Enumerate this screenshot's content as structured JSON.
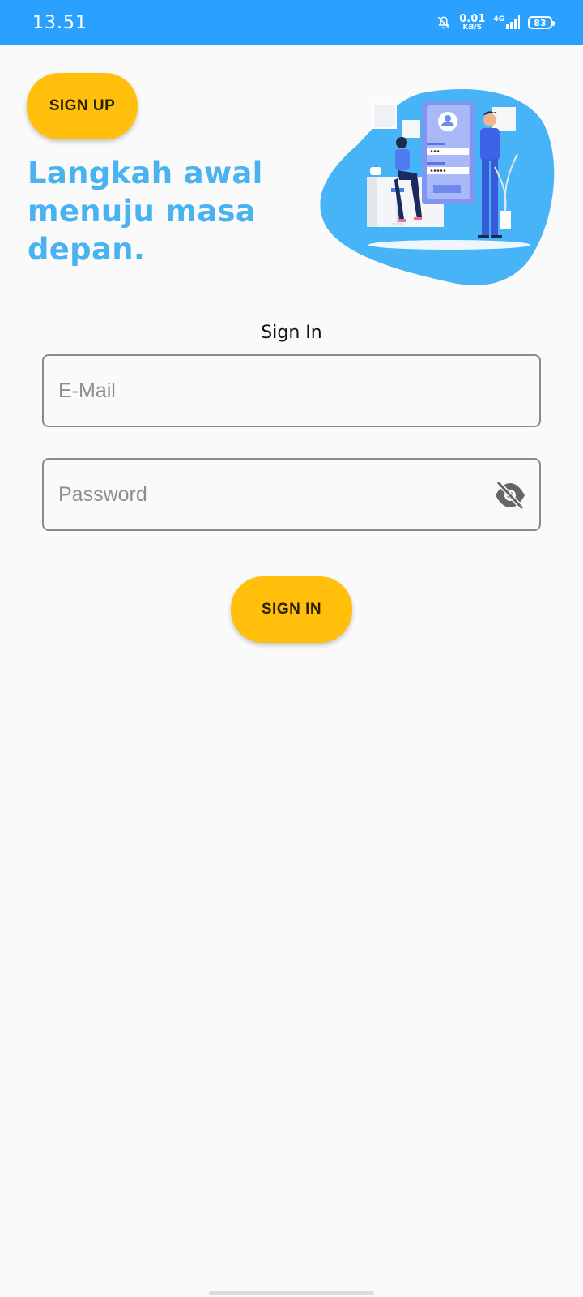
{
  "status_bar": {
    "time": "13.51",
    "net_speed_value": "0.01",
    "net_speed_unit": "KB/S",
    "network_type": "4G",
    "battery": "83",
    "bg_color": "#2aa0ff",
    "icons": [
      "bell-muted-icon",
      "signal-icon",
      "battery-icon"
    ]
  },
  "header": {
    "signup_label": "SIGN UP",
    "tagline": "Langkah awal menuju masa depan.",
    "tagline_color": "#49b2f1",
    "illustration": "login-illustration"
  },
  "form": {
    "heading": "Sign In",
    "email_placeholder": "E-Mail",
    "email_value": "",
    "password_placeholder": "Password",
    "password_value": "",
    "password_toggle_icon": "eye-off-icon",
    "signin_label": "SIGN IN"
  },
  "colors": {
    "accent_button": "#ffbf0b",
    "background": "#fafafa"
  }
}
